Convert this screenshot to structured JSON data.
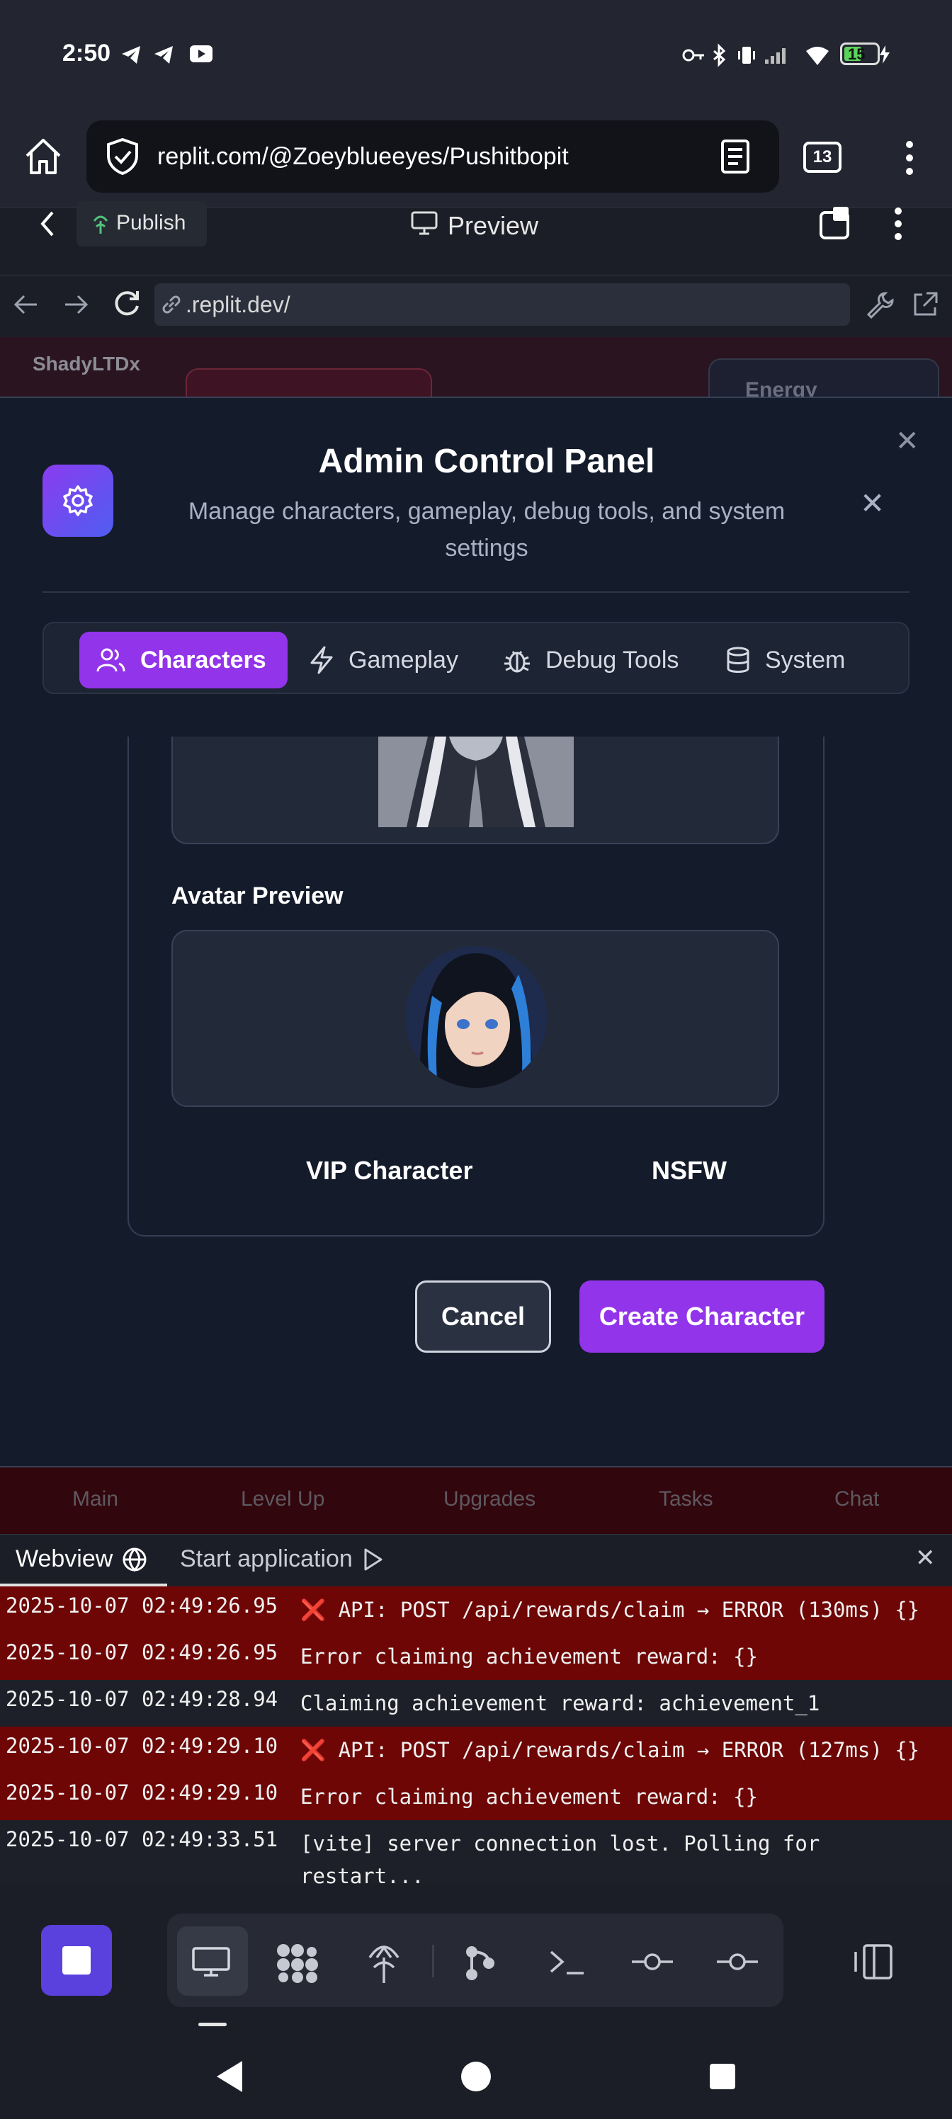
{
  "status_bar": {
    "time": "2:50",
    "battery": "15"
  },
  "browser": {
    "url": "replit.com/@Zoeyblueeyes/Pushitbopit",
    "tab_count": "13"
  },
  "replit_header": {
    "publish_label": "Publish",
    "preview_label": "Preview"
  },
  "webview_address": {
    "url": ".replit.dev/"
  },
  "game": {
    "username": "ShadyLTDx",
    "energy_label": "Energy",
    "nav": [
      "Main",
      "Level Up",
      "Upgrades",
      "Tasks",
      "Chat"
    ]
  },
  "modal": {
    "title": "Admin Control Panel",
    "subtitle": "Manage characters, gameplay, debug tools, and system settings",
    "tabs": [
      {
        "label": "Characters",
        "active": true
      },
      {
        "label": "Gameplay",
        "active": false
      },
      {
        "label": "Debug Tools",
        "active": false
      },
      {
        "label": "System",
        "active": false
      }
    ],
    "avatar_preview_label": "Avatar Preview",
    "vip_label": "VIP Character",
    "nsfw_label": "NSFW",
    "cancel_label": "Cancel",
    "create_label": "Create Character"
  },
  "console": {
    "tabs": [
      "Webview",
      "Start application"
    ],
    "logs": [
      {
        "ts": "2025-10-07 02:49:26.95",
        "msg": "❌ API: POST /api/rewards/claim → ERROR (130ms) {}",
        "level": "error"
      },
      {
        "ts": "2025-10-07 02:49:26.95",
        "msg": "Error claiming achievement reward: {}",
        "level": "error"
      },
      {
        "ts": "2025-10-07 02:49:28.94",
        "msg": "Claiming achievement reward: achievement_1",
        "level": "info"
      },
      {
        "ts": "2025-10-07 02:49:29.10",
        "msg": "❌ API: POST /api/rewards/claim → ERROR (127ms) {}",
        "level": "error"
      },
      {
        "ts": "2025-10-07 02:49:29.10",
        "msg": "Error claiming achievement reward: {}",
        "level": "error"
      },
      {
        "ts": "2025-10-07 02:49:33.51",
        "msg": "[vite] server connection lost. Polling for restart...",
        "level": "info"
      }
    ]
  },
  "colors": {
    "accent": "#9234ea",
    "error_row": "#6e0606",
    "modal_bg": "#141b2b"
  }
}
